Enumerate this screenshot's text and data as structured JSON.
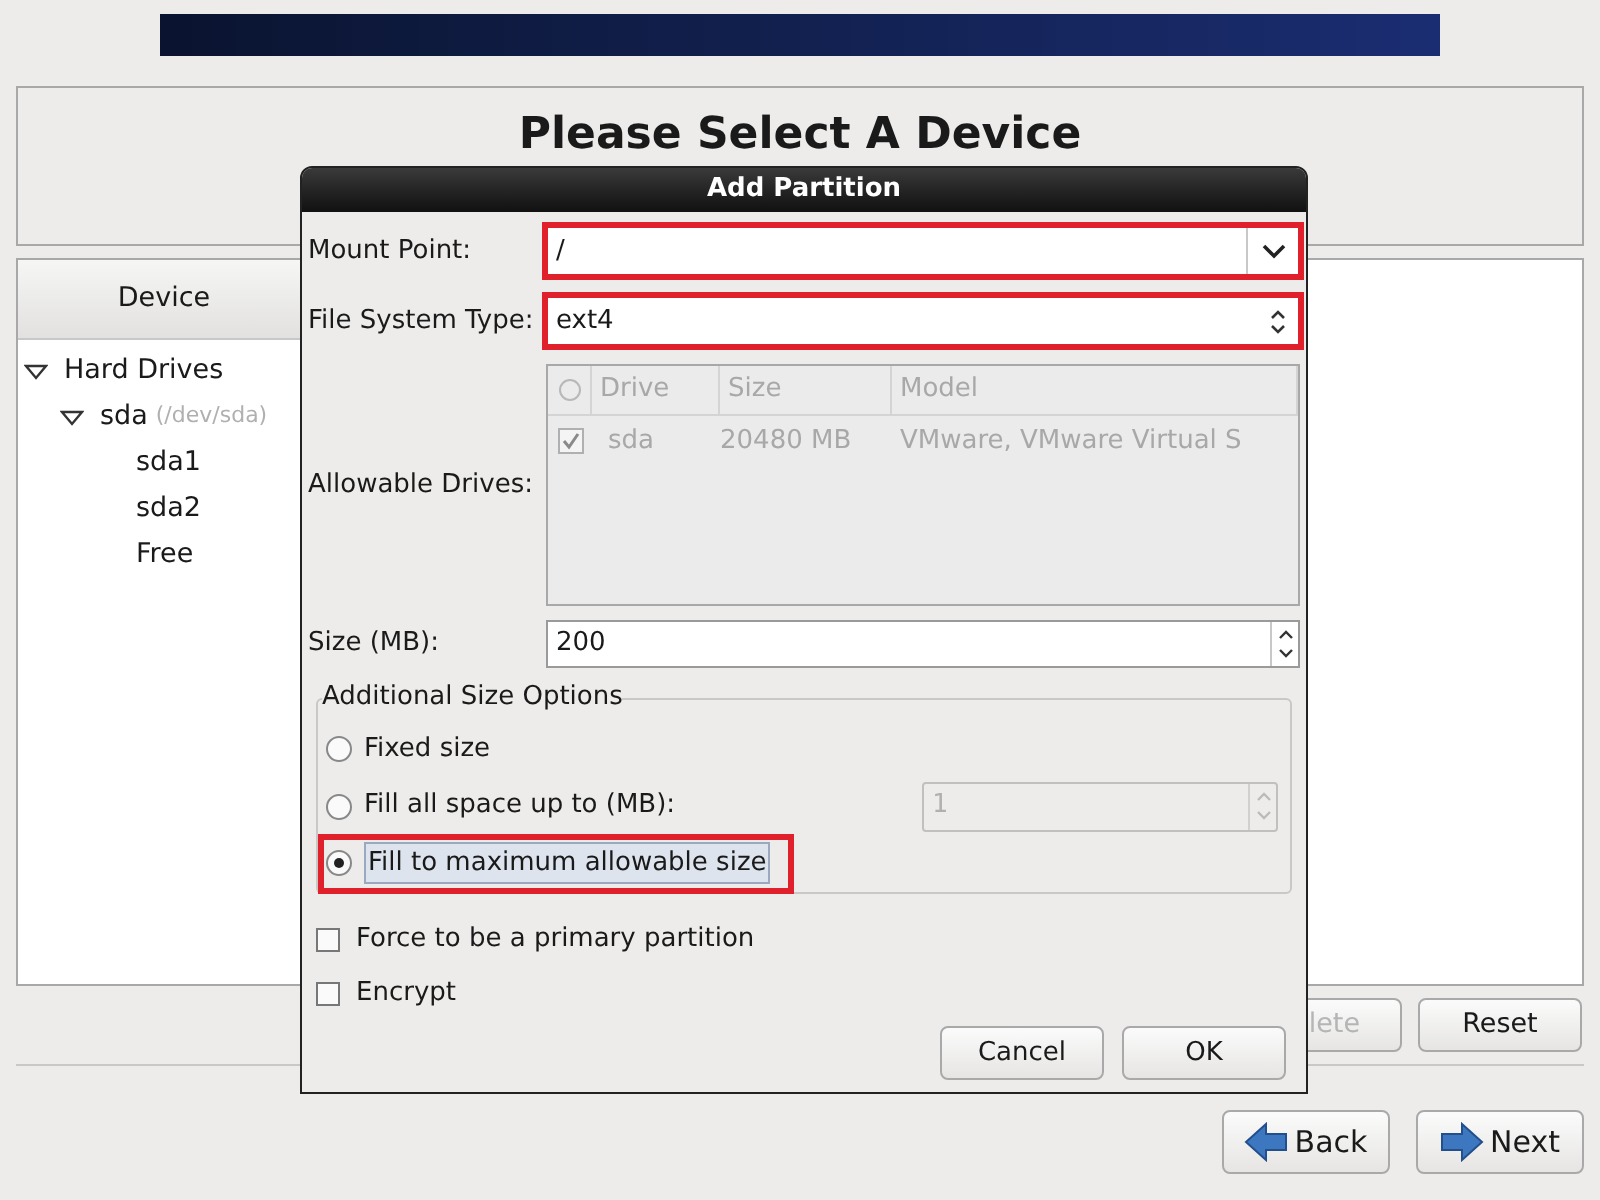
{
  "page": {
    "heading": "Please Select A Device"
  },
  "device_tree": {
    "column": "Device",
    "items": [
      {
        "label": "Hard Drives",
        "expanded": true,
        "children": [
          {
            "label": "sda",
            "detail": "(/dev/sda)",
            "expanded": true,
            "children": [
              {
                "label": "sda1"
              },
              {
                "label": "sda2"
              },
              {
                "label": "Free"
              }
            ]
          }
        ]
      }
    ]
  },
  "actions": [
    {
      "label": "lete",
      "disabled": true
    },
    {
      "label": "Reset",
      "disabled": false
    }
  ],
  "nav": [
    {
      "label": "Back",
      "kind": "back"
    },
    {
      "label": "Next",
      "kind": "next"
    }
  ],
  "dialog": {
    "title": "Add Partition",
    "mount_point": {
      "label": "Mount Point:",
      "value": "/",
      "highlighted": true
    },
    "fs_type": {
      "label": "File System Type:",
      "value": "ext4",
      "highlighted": true
    },
    "drives": {
      "label": "Allowable Drives:",
      "columns": [
        "Drive",
        "Size",
        "Model"
      ],
      "rows": [
        {
          "checked": true,
          "drive": "sda",
          "size": "20480 MB",
          "model": "VMware, VMware Virtual S"
        }
      ]
    },
    "size": {
      "label": "Size (MB):",
      "value": "200"
    },
    "size_options": {
      "title": "Additional Size Options",
      "options": [
        {
          "label": "Fixed size",
          "selected": false,
          "highlighted": false
        },
        {
          "label": "Fill all space up to (MB):",
          "selected": false,
          "highlighted": false,
          "value": "1"
        },
        {
          "label": "Fill to maximum allowable size",
          "selected": true,
          "highlighted": true
        }
      ]
    },
    "checks": [
      {
        "label": "Force to be a primary partition",
        "checked": false
      },
      {
        "label": "Encrypt",
        "checked": false
      }
    ],
    "buttons": [
      "Cancel",
      "OK"
    ]
  }
}
